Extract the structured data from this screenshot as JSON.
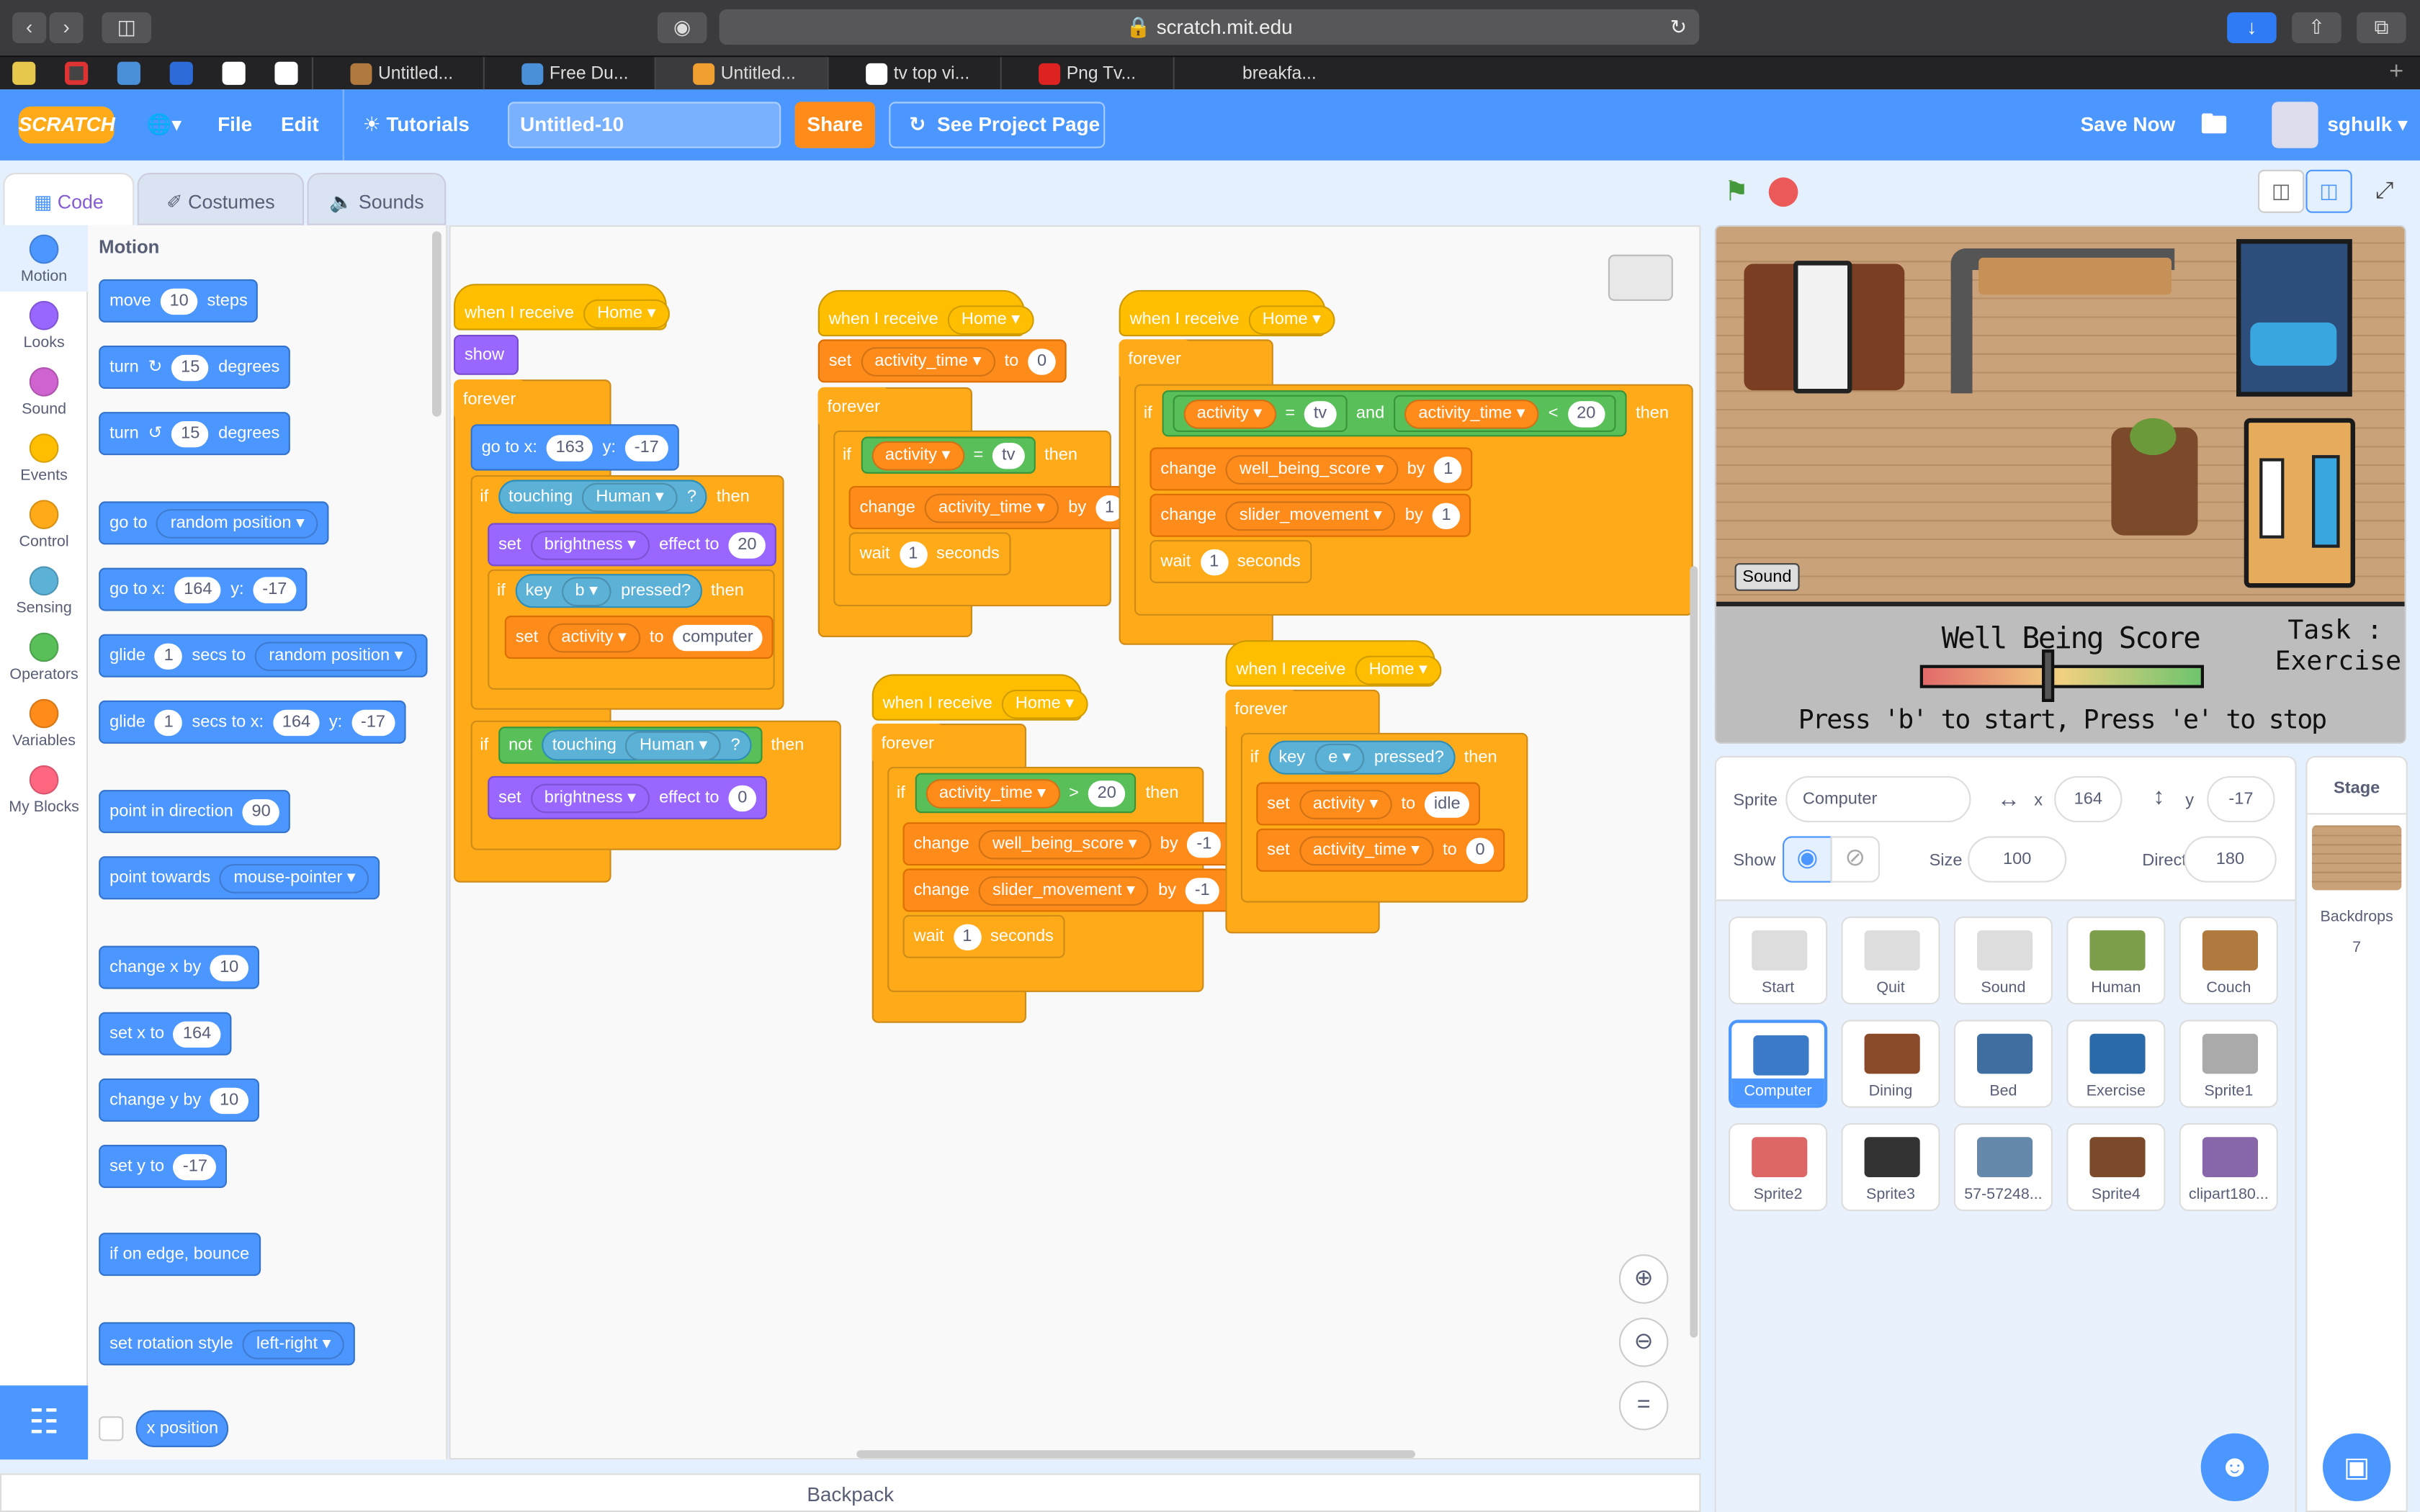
{
  "browser": {
    "url": "scratch.mit.edu",
    "tabs": [
      "Untitled...",
      "Free Du...",
      "Untitled...",
      "tv top vi...",
      "Png Tv...",
      "breakfa..."
    ]
  },
  "menu": {
    "logo": "SCRATCH",
    "file": "File",
    "edit": "Edit",
    "tutorials": "Tutorials",
    "project_title": "Untitled-10",
    "share": "Share",
    "see_project": "See Project Page",
    "save_now": "Save Now",
    "username": "sghulk"
  },
  "editor_tabs": {
    "code": "Code",
    "costumes": "Costumes",
    "sounds": "Sounds"
  },
  "categories": [
    {
      "label": "Motion",
      "color": "#4c97ff"
    },
    {
      "label": "Looks",
      "color": "#9966ff"
    },
    {
      "label": "Sound",
      "color": "#cf63cf"
    },
    {
      "label": "Events",
      "color": "#ffbf00"
    },
    {
      "label": "Control",
      "color": "#ffab19"
    },
    {
      "label": "Sensing",
      "color": "#5cb1d6"
    },
    {
      "label": "Operators",
      "color": "#59c059"
    },
    {
      "label": "Variables",
      "color": "#ff8c1a"
    },
    {
      "label": "My Blocks",
      "color": "#ff6680"
    }
  ],
  "palette": {
    "heading": "Motion",
    "move": "move",
    "steps": "steps",
    "v10": "10",
    "turn": "turn",
    "degrees": "degrees",
    "v15": "15",
    "goto": "go to",
    "random_position": "random position",
    "gotoxy": "go to x:",
    "y": "y:",
    "x164": "164",
    "y_neg17": "-17",
    "glide": "glide",
    "v1": "1",
    "secs_to": "secs to",
    "secs_to_x": "secs to x:",
    "point_dir": "point in direction",
    "v90": "90",
    "point_towards": "point towards",
    "mouse_pointer": "mouse-pointer",
    "change_x": "change x by",
    "set_x": "set x to",
    "change_y": "change y by",
    "set_y": "set y to",
    "edge_bounce": "if on edge, bounce",
    "rot_style": "set rotation style",
    "left_right": "left-right",
    "x_position": "x position"
  },
  "script": {
    "when_receive": "when I receive",
    "home": "Home",
    "show": "show",
    "forever": "forever",
    "goto_x": "go to x:",
    "y": "y:",
    "v163": "163",
    "v_neg17": "-17",
    "if": "if",
    "then": "then",
    "touching": "touching",
    "human": "Human",
    "q": "?",
    "set": "set",
    "brightness": "brightness",
    "effect_to": "effect to",
    "v20": "20",
    "v0": "0",
    "key": "key",
    "b": "b",
    "e": "e",
    "pressed": "pressed?",
    "activity": "activity",
    "to": "to",
    "computer": "computer",
    "not": "not",
    "activity_time": "activity_time",
    "change": "change",
    "by": "by",
    "v1": "1",
    "v_neg1": "-1",
    "wait": "wait",
    "seconds": "seconds",
    "eq": "=",
    "tv": "tv",
    "gt": ">",
    "lt": "<",
    "and": "and",
    "well_being_score": "well_being_score",
    "slider_movement": "slider_movement",
    "idle": "idle"
  },
  "stage": {
    "sound_label": "Sound",
    "score_title": "Well Being Score",
    "task_label": "Task :",
    "task_value": "Exercise",
    "instruction": "Press 'b' to start, Press 'e' to stop",
    "slider_level": 0.45
  },
  "sprite_info": {
    "sprite_lbl": "Sprite",
    "name": "Computer",
    "x_lbl": "x",
    "x": "164",
    "y_lbl": "y",
    "y": "-17",
    "show_lbl": "Show",
    "size_lbl": "Size",
    "size": "100",
    "dir_lbl": "Direction",
    "direction": "180"
  },
  "sprites": [
    {
      "name": "Start",
      "color": "#ddd"
    },
    {
      "name": "Quit",
      "color": "#ddd"
    },
    {
      "name": "Sound",
      "color": "#ddd"
    },
    {
      "name": "Human",
      "color": "#7c9e4b"
    },
    {
      "name": "Couch",
      "color": "#b07a3e"
    },
    {
      "name": "Computer",
      "color": "#3a7ac7"
    },
    {
      "name": "Dining",
      "color": "#8a4a2a"
    },
    {
      "name": "Bed",
      "color": "#3f6fa0"
    },
    {
      "name": "Exercise",
      "color": "#2a6aa8"
    },
    {
      "name": "Sprite1",
      "color": "#aaa"
    },
    {
      "name": "Sprite2",
      "color": "#d66"
    },
    {
      "name": "Sprite3",
      "color": "#333"
    },
    {
      "name": "57-57248...",
      "color": "#6688aa"
    },
    {
      "name": "Sprite4",
      "color": "#7a4a2a"
    },
    {
      "name": "clipart180...",
      "color": "#8866aa"
    }
  ],
  "stage_panel": {
    "title": "Stage",
    "backdrops_lbl": "Backdrops",
    "backdrops_count": "7"
  },
  "backpack": "Backpack"
}
